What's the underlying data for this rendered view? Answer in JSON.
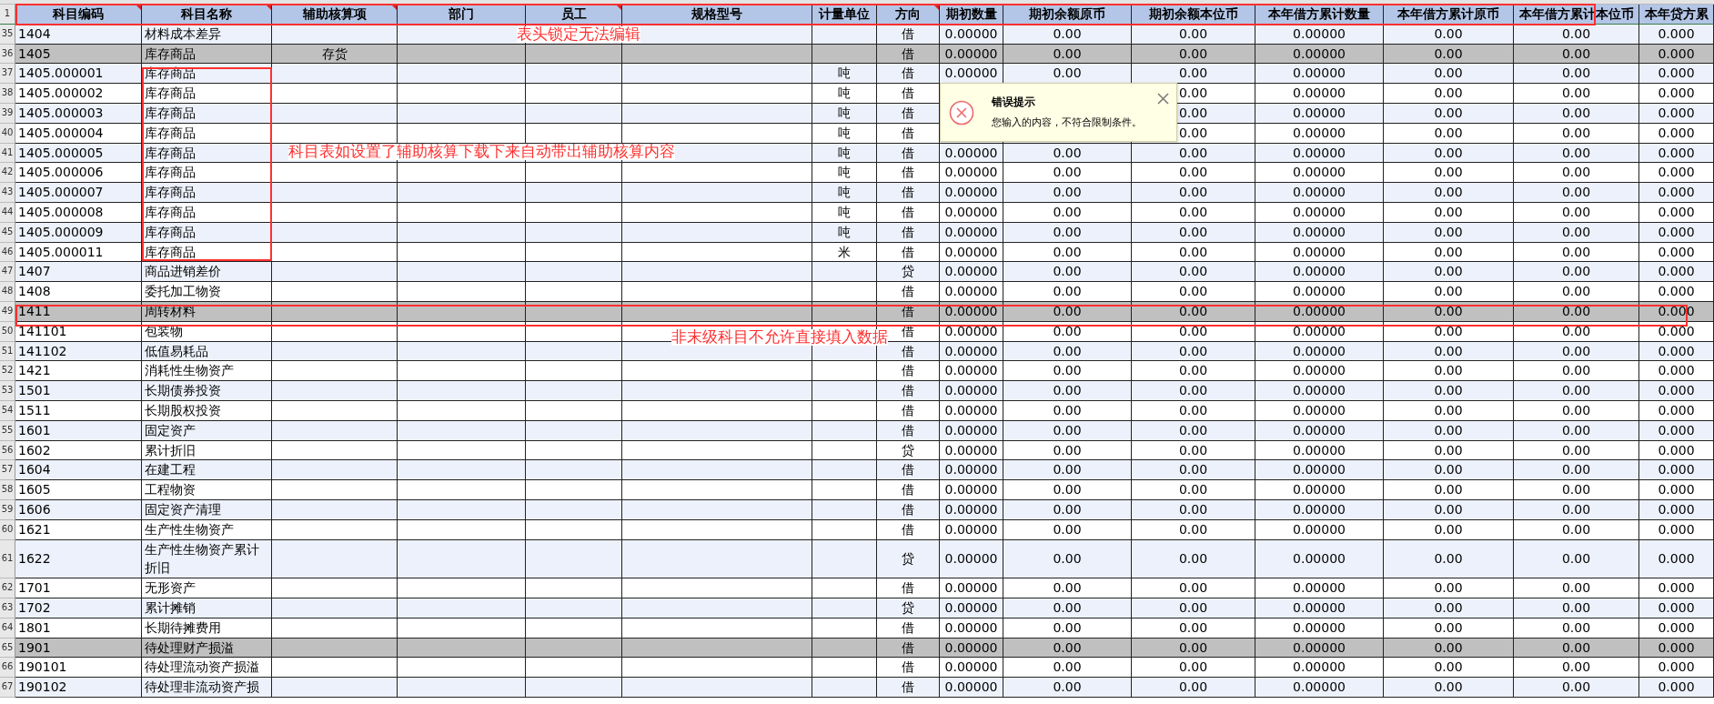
{
  "columns": [
    {
      "label": "科目编码",
      "comment": true
    },
    {
      "label": "科目名称",
      "comment": true
    },
    {
      "label": "辅助核算项",
      "comment": true
    },
    {
      "label": "部门",
      "comment": false
    },
    {
      "label": "员工",
      "comment": true
    },
    {
      "label": "规格型号",
      "comment": false
    },
    {
      "label": "计量单位",
      "comment": false
    },
    {
      "label": "方向",
      "comment": true
    },
    {
      "label": "期初数量",
      "comment": false
    },
    {
      "label": "期初余额原币",
      "comment": false
    },
    {
      "label": "期初余额本位币",
      "comment": false
    },
    {
      "label": "本年借方累计数量",
      "comment": false
    },
    {
      "label": "本年借方累计原币",
      "comment": false
    },
    {
      "label": "本年借方累计本位币",
      "comment": false
    },
    {
      "label": "本年贷方累",
      "comment": false
    }
  ],
  "header_row_number": "1",
  "rows": [
    {
      "number": "35",
      "code": "1404",
      "name": "材料成本差异",
      "direction": "借",
      "parent": false,
      "values": [
        "0.00000",
        "0.00",
        "0.00",
        "0.00000",
        "0.00",
        "0.00",
        "0.000"
      ]
    },
    {
      "number": "36",
      "code": "1405",
      "name": "库存商品",
      "aux": "存货",
      "direction": "借",
      "parent": true,
      "values": [
        "0.00000",
        "0.00",
        "0.00",
        "0.00000",
        "0.00",
        "0.00",
        "0.000"
      ]
    },
    {
      "number": "37",
      "code": "1405.000001",
      "name": "库存商品",
      "unit": "吨",
      "direction": "借",
      "parent": false,
      "values": [
        "0.00000",
        "0.00",
        "0.00",
        "0.00000",
        "0.00",
        "0.00",
        "0.000"
      ]
    },
    {
      "number": "38",
      "code": "1405.000002",
      "name": "库存商品",
      "unit": "吨",
      "direction": "借",
      "parent": false,
      "values": [
        "0.00",
        "0.00000",
        "0.00",
        "0.00",
        "0.000"
      ]
    },
    {
      "number": "39",
      "code": "1405.000003",
      "name": "库存商品",
      "unit": "吨",
      "direction": "借",
      "parent": false,
      "values": [
        "0.00",
        "0.00000",
        "0.00",
        "0.00",
        "0.000"
      ]
    },
    {
      "number": "40",
      "code": "1405.000004",
      "name": "库存商品",
      "unit": "吨",
      "direction": "借",
      "parent": false,
      "values": [
        "0.00",
        "0.00000",
        "0.00",
        "0.00",
        "0.000"
      ]
    },
    {
      "number": "41",
      "code": "1405.000005",
      "name": "库存商品",
      "unit": "吨",
      "direction": "借",
      "parent": false,
      "values": [
        "0.00000",
        "0.00",
        "0.00",
        "0.00000",
        "0.00",
        "0.00",
        "0.000"
      ]
    },
    {
      "number": "42",
      "code": "1405.000006",
      "name": "库存商品",
      "unit": "吨",
      "direction": "借",
      "parent": false,
      "values": [
        "0.00000",
        "0.00",
        "0.00",
        "0.00000",
        "0.00",
        "0.00",
        "0.000"
      ]
    },
    {
      "number": "43",
      "code": "1405.000007",
      "name": "库存商品",
      "unit": "吨",
      "direction": "借",
      "parent": false,
      "values": [
        "0.00000",
        "0.00",
        "0.00",
        "0.00000",
        "0.00",
        "0.00",
        "0.000"
      ]
    },
    {
      "number": "44",
      "code": "1405.000008",
      "name": "库存商品",
      "unit": "吨",
      "direction": "借",
      "parent": false,
      "values": [
        "0.00000",
        "0.00",
        "0.00",
        "0.00000",
        "0.00",
        "0.00",
        "0.000"
      ]
    },
    {
      "number": "45",
      "code": "1405.000009",
      "name": "库存商品",
      "unit": "吨",
      "direction": "借",
      "parent": false,
      "values": [
        "0.00000",
        "0.00",
        "0.00",
        "0.00000",
        "0.00",
        "0.00",
        "0.000"
      ]
    },
    {
      "number": "46",
      "code": "1405.000011",
      "name": "库存商品",
      "unit": "米",
      "direction": "借",
      "parent": false,
      "values": [
        "0.00000",
        "0.00",
        "0.00",
        "0.00000",
        "0.00",
        "0.00",
        "0.000"
      ]
    },
    {
      "number": "47",
      "code": "1407",
      "name": "商品进销差价",
      "direction": "贷",
      "parent": false,
      "values": [
        "0.00000",
        "0.00",
        "0.00",
        "0.00000",
        "0.00",
        "0.00",
        "0.000"
      ]
    },
    {
      "number": "48",
      "code": "1408",
      "name": "委托加工物资",
      "direction": "借",
      "parent": false,
      "values": [
        "0.00000",
        "0.00",
        "0.00",
        "0.00000",
        "0.00",
        "0.00",
        "0.000"
      ]
    },
    {
      "number": "49",
      "code": "1411",
      "name": "周转材料",
      "direction": "借",
      "parent": true,
      "values": [
        "0.00000",
        "0.00",
        "0.00",
        "0.00000",
        "0.00",
        "0.00",
        "0.000"
      ]
    },
    {
      "number": "50",
      "code": "141101",
      "name": "包装物",
      "direction": "借",
      "parent": false,
      "values": [
        "0.00000",
        "0.00",
        "0.00",
        "0.00000",
        "0.00",
        "0.00",
        "0.000"
      ]
    },
    {
      "number": "51",
      "code": "141102",
      "name": "低值易耗品",
      "direction": "借",
      "parent": false,
      "values": [
        "0.00000",
        "0.00",
        "0.00",
        "0.00000",
        "0.00",
        "0.00",
        "0.000"
      ]
    },
    {
      "number": "52",
      "code": "1421",
      "name": "消耗性生物资产",
      "direction": "借",
      "parent": false,
      "values": [
        "0.00000",
        "0.00",
        "0.00",
        "0.00000",
        "0.00",
        "0.00",
        "0.000"
      ]
    },
    {
      "number": "53",
      "code": "1501",
      "name": "长期债券投资",
      "direction": "借",
      "parent": false,
      "values": [
        "0.00000",
        "0.00",
        "0.00",
        "0.00000",
        "0.00",
        "0.00",
        "0.000"
      ]
    },
    {
      "number": "54",
      "code": "1511",
      "name": "长期股权投资",
      "direction": "借",
      "parent": false,
      "values": [
        "0.00000",
        "0.00",
        "0.00",
        "0.00000",
        "0.00",
        "0.00",
        "0.000"
      ]
    },
    {
      "number": "55",
      "code": "1601",
      "name": "固定资产",
      "direction": "借",
      "parent": false,
      "values": [
        "0.00000",
        "0.00",
        "0.00",
        "0.00000",
        "0.00",
        "0.00",
        "0.000"
      ]
    },
    {
      "number": "56",
      "code": "1602",
      "name": "累计折旧",
      "direction": "贷",
      "parent": false,
      "values": [
        "0.00000",
        "0.00",
        "0.00",
        "0.00000",
        "0.00",
        "0.00",
        "0.000"
      ]
    },
    {
      "number": "57",
      "code": "1604",
      "name": "在建工程",
      "direction": "借",
      "parent": false,
      "values": [
        "0.00000",
        "0.00",
        "0.00",
        "0.00000",
        "0.00",
        "0.00",
        "0.000"
      ]
    },
    {
      "number": "58",
      "code": "1605",
      "name": "工程物资",
      "direction": "借",
      "parent": false,
      "values": [
        "0.00000",
        "0.00",
        "0.00",
        "0.00000",
        "0.00",
        "0.00",
        "0.000"
      ]
    },
    {
      "number": "59",
      "code": "1606",
      "name": "固定资产清理",
      "direction": "借",
      "parent": false,
      "values": [
        "0.00000",
        "0.00",
        "0.00",
        "0.00000",
        "0.00",
        "0.00",
        "0.000"
      ]
    },
    {
      "number": "60",
      "code": "1621",
      "name": "生产性生物资产",
      "direction": "借",
      "parent": false,
      "values": [
        "0.00000",
        "0.00",
        "0.00",
        "0.00000",
        "0.00",
        "0.00",
        "0.000"
      ]
    },
    {
      "number": "61",
      "code": "1622",
      "name": "生产性生物资产累计折旧",
      "direction": "贷",
      "parent": false,
      "values": [
        "0.00000",
        "0.00",
        "0.00",
        "0.00000",
        "0.00",
        "0.00",
        "0.000"
      ]
    },
    {
      "number": "62",
      "code": "1701",
      "name": "无形资产",
      "direction": "借",
      "parent": false,
      "values": [
        "0.00000",
        "0.00",
        "0.00",
        "0.00000",
        "0.00",
        "0.00",
        "0.000"
      ]
    },
    {
      "number": "63",
      "code": "1702",
      "name": "累计摊销",
      "direction": "贷",
      "parent": false,
      "values": [
        "0.00000",
        "0.00",
        "0.00",
        "0.00000",
        "0.00",
        "0.00",
        "0.000"
      ]
    },
    {
      "number": "64",
      "code": "1801",
      "name": "长期待摊费用",
      "direction": "借",
      "parent": false,
      "values": [
        "0.00000",
        "0.00",
        "0.00",
        "0.00000",
        "0.00",
        "0.00",
        "0.000"
      ]
    },
    {
      "number": "65",
      "code": "1901",
      "name": "待处理财产损溢",
      "direction": "借",
      "parent": true,
      "values": [
        "0.00000",
        "0.00",
        "0.00",
        "0.00000",
        "0.00",
        "0.00",
        "0.000"
      ]
    },
    {
      "number": "66",
      "code": "190101",
      "name": "待处理流动资产损溢",
      "direction": "借",
      "parent": false,
      "values": [
        "0.00000",
        "0.00",
        "0.00",
        "0.00000",
        "0.00",
        "0.00",
        "0.000"
      ]
    },
    {
      "number": "67",
      "code": "190102",
      "name": "待处理非流动资产损",
      "direction": "借",
      "parent": false,
      "values": [
        "0.00000",
        "0.00",
        "0.00",
        "0.00000",
        "0.00",
        "0.00",
        "0.000"
      ]
    }
  ],
  "error_tooltip": {
    "title": "错误提示",
    "message": "您输入的内容，不符合限制条件。"
  },
  "annotations": [
    {
      "text": "表头锁定无法编辑"
    },
    {
      "text": "科目表如设置了辅助核算下载下来自动带出辅助核算内容"
    },
    {
      "text": "非末级科目不允许直接填入数据"
    }
  ]
}
